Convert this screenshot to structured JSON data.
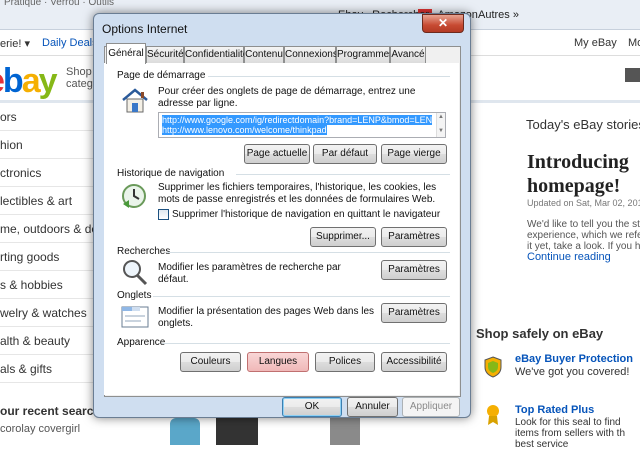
{
  "browser": {
    "fav_fragment": "Pratique · Verrou · Outils",
    "fav_right": [
      "Ebay",
      "Rechercher",
      "Amazon"
    ],
    "autres": "Autres »"
  },
  "ebay": {
    "nav_left": "erie! ▾",
    "daily_deals": "Daily Deals",
    "my_ebay": "My eBay",
    "more": "Mo",
    "logo": [
      "e",
      "b",
      "a",
      "y"
    ],
    "shop_by": "Shop",
    "category": "categ",
    "categories": [
      "ors",
      "hion",
      "ctronics",
      "lectibles & art",
      "me, outdoors & deco",
      "rting goods",
      "s & hobbies",
      "welry & watches",
      "alth & beauty",
      "als & gifts"
    ],
    "recent_searches": "our recent search",
    "recent_query": "corolay covergirl",
    "stories_title": "Today's eBay stories",
    "headline_1": "Introducing",
    "headline_2": "homepage!",
    "updated": "Updated on Sat, Mar 02, 2013",
    "story_lines": [
      "We'd like to tell you the st",
      "experience, which we refe",
      "it yet, take a look. If you hi"
    ],
    "continue": "Continue reading",
    "shop_safely": "Shop safely on eBay",
    "protection_title": "eBay Buyer Protection",
    "protection_sub": "We've got you covered!",
    "top_rated_title": "Top Rated Plus",
    "top_rated_lines": [
      "Look for this seal to find",
      "items from sellers with th",
      "best service"
    ]
  },
  "dialog": {
    "title": "Options Internet",
    "close": "✕",
    "tabs": [
      "Général",
      "Sécurité",
      "Confidentialité",
      "Contenu",
      "Connexions",
      "Programmes",
      "Avancé"
    ],
    "home": {
      "title": "Page de démarrage",
      "desc": "Pour créer des onglets de page de démarrage, entrez une adresse par ligne.",
      "urls": [
        "http://www.google.com/ig/redirectdomain?brand=LENP&bmod=LEN",
        "http://www.lenovo.com/welcome/thinkpad"
      ],
      "btn_current": "Page actuelle",
      "btn_default": "Par défaut",
      "btn_blank": "Page vierge"
    },
    "history": {
      "title": "Historique de navigation",
      "desc": "Supprimer les fichiers temporaires, l'historique, les cookies, les mots de passe enregistrés et les données de formulaires Web.",
      "checkbox": "Supprimer l'historique de navigation en quittant le navigateur",
      "checked": false,
      "btn_delete": "Supprimer...",
      "btn_settings": "Paramètres"
    },
    "search": {
      "title": "Recherches",
      "desc": "Modifier les paramètres de recherche par défaut.",
      "btn_settings": "Paramètres"
    },
    "tabs_group": {
      "title": "Onglets",
      "desc": "Modifier la présentation des pages Web dans les onglets.",
      "btn_settings": "Paramètres"
    },
    "appearance": {
      "title": "Apparence",
      "btn_colors": "Couleurs",
      "btn_languages": "Langues",
      "btn_fonts": "Polices",
      "btn_accessibility": "Accessibilité"
    },
    "footer": {
      "ok": "OK",
      "cancel": "Annuler",
      "apply": "Appliquer"
    }
  }
}
